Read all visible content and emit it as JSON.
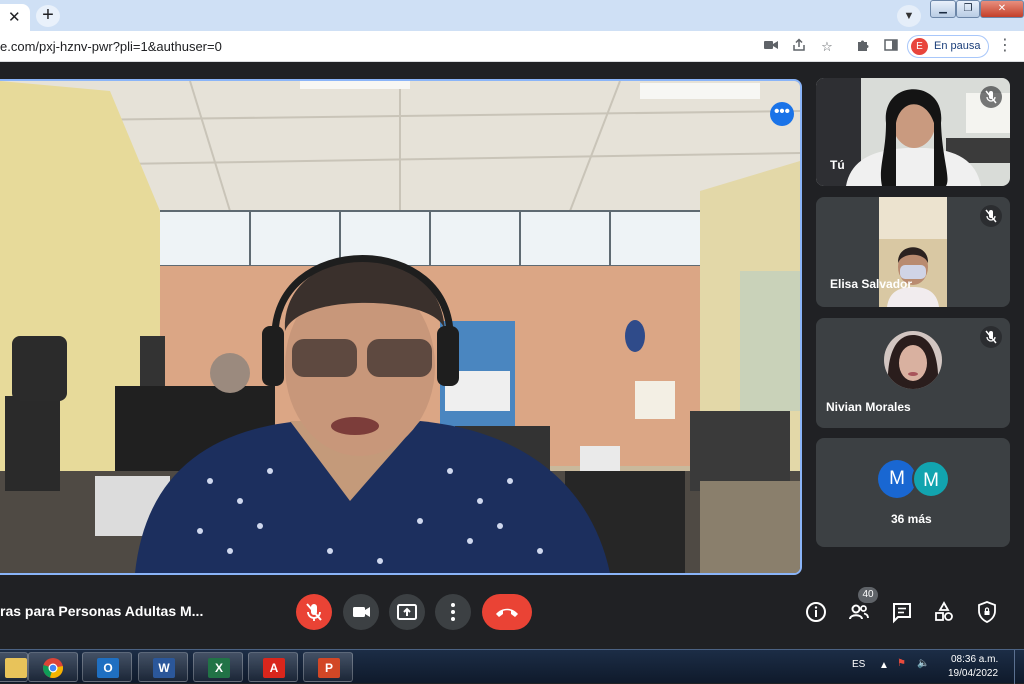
{
  "browser": {
    "tab_close": "✕",
    "new_tab": "+",
    "url": "e.com/pxj-hznv-pwr?pli=1&authuser=0",
    "profile_initial": "E",
    "profile_label": "En pausa"
  },
  "meet": {
    "tiles": [
      {
        "name": "Tú"
      },
      {
        "name": "Elisa Salvador"
      },
      {
        "name": "Nivian Morales"
      },
      {
        "name": "36 más",
        "avatars": [
          "M",
          "M"
        ]
      }
    ],
    "meeting_title": "ras para Personas Adultas M...",
    "participants_count": "40"
  },
  "taskbar": {
    "language": "ES",
    "time": "08:36 a.m.",
    "date": "19/04/2022"
  },
  "colors": {
    "accent": "#8ab4f8",
    "end_call": "#ea4335",
    "avatar_1": "#1967d2",
    "avatar_2": "#12a4af"
  }
}
